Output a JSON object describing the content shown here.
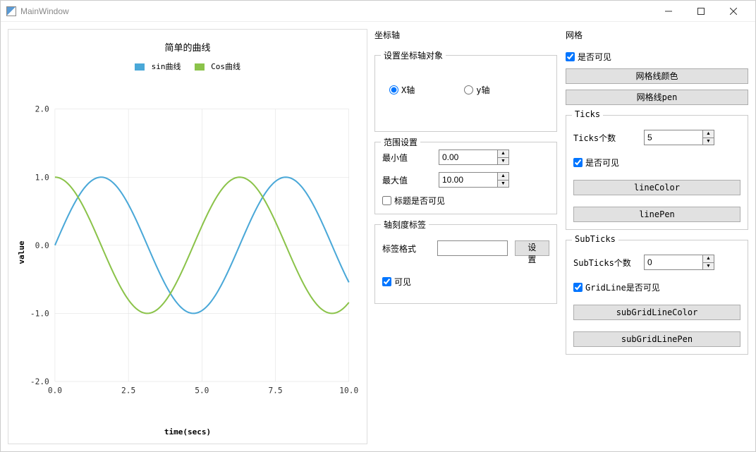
{
  "window": {
    "title": "MainWindow"
  },
  "chart_data": {
    "type": "line",
    "title": "简单的曲线",
    "xlabel": "time(secs)",
    "ylabel": "value",
    "xlim": [
      0,
      10
    ],
    "ylim": [
      -2,
      2
    ],
    "xticks": [
      0.0,
      2.5,
      5.0,
      7.5,
      10.0
    ],
    "yticks": [
      -2.0,
      -1.0,
      0.0,
      1.0,
      2.0
    ],
    "series": [
      {
        "name": "sin曲线",
        "color": "#4aa8d8",
        "fn": "sin",
        "phase": 0
      },
      {
        "name": "Cos曲线",
        "color": "#8bc34a",
        "fn": "cos",
        "phase": 0
      }
    ]
  },
  "panels": {
    "axis": {
      "title": "坐标轴",
      "targetTitle": "设置坐标轴对象",
      "xAxis": "X轴",
      "yAxis": "y轴",
      "rangeTitle": "范围设置",
      "min": "最小值",
      "minValue": "0.00",
      "max": "最大值",
      "maxValue": "10.00",
      "titleVisible": "标题是否可见",
      "tickLabelTitle": "轴刻度标签",
      "labelFormat": "标签格式",
      "setBtn": "设置",
      "visible": "可见"
    },
    "grid": {
      "title": "网格",
      "visible": "是否可见",
      "gridColor": "网格线颜色",
      "gridPen": "网格线pen",
      "ticksTitle": "Ticks",
      "ticksCount": "Ticks个数",
      "ticksCountValue": "5",
      "ticksVisible": "是否可见",
      "lineColor": "lineColor",
      "linePen": "linePen",
      "subTicksTitle": "SubTicks",
      "subTicksCount": "SubTicks个数",
      "subTicksCountValue": "0",
      "gridLineVisible": "GridLine是否可见",
      "subGridLineColor": "subGridLineColor",
      "subGridLinePen": "subGridLinePen"
    }
  }
}
